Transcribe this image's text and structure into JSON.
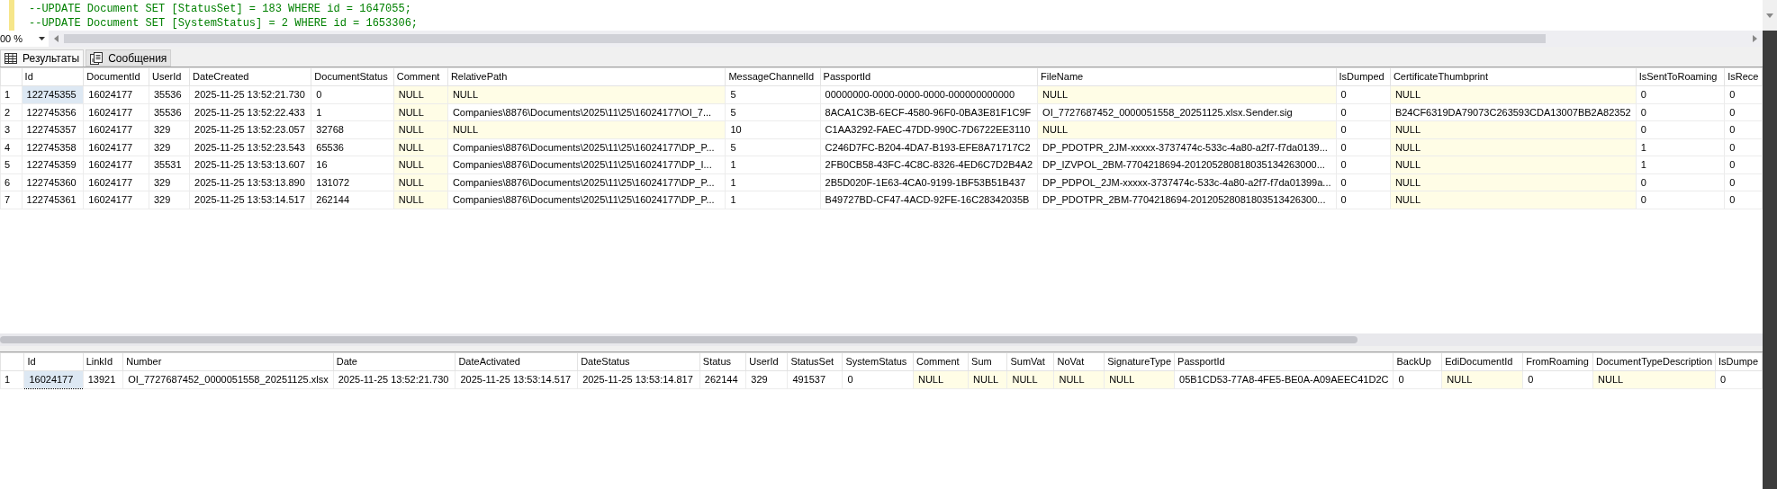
{
  "editor": {
    "lines": [
      "--UPDATE Document SET [StatusSet] = 183 WHERE id = 1647055;",
      "--UPDATE Document SET [SystemStatus] = 2 WHERE id = 1653306;"
    ]
  },
  "zoom": {
    "value": "00 %"
  },
  "tabs": [
    {
      "label": "Результаты",
      "selected": true,
      "kind": "grid"
    },
    {
      "label": "Сообщения",
      "selected": false,
      "kind": "messages"
    }
  ],
  "grids": [
    {
      "columns": [
        "Id",
        "DocumentId",
        "UserId",
        "DateCreated",
        "DocumentStatus",
        "Comment",
        "RelativePath",
        "MessageChannelId",
        "PassportId",
        "FileName",
        "IsDumped",
        "CertificateThumbprint",
        "IsSentToRoaming",
        "IsRece"
      ],
      "rows": [
        {
          "number": "1",
          "cells": [
            {
              "text": "122745355",
              "is_null": false,
              "selected": true
            },
            {
              "text": "16024177",
              "is_null": false,
              "selected": false
            },
            {
              "text": "35536",
              "is_null": false,
              "selected": false
            },
            {
              "text": "2025-11-25 13:52:21.730",
              "is_null": false,
              "selected": false
            },
            {
              "text": "0",
              "is_null": false,
              "selected": false
            },
            {
              "text": "NULL",
              "is_null": true,
              "selected": false
            },
            {
              "text": "NULL",
              "is_null": true,
              "selected": false
            },
            {
              "text": "5",
              "is_null": false,
              "selected": false
            },
            {
              "text": "00000000-0000-0000-0000-000000000000",
              "is_null": false,
              "selected": false
            },
            {
              "text": "NULL",
              "is_null": true,
              "selected": false
            },
            {
              "text": "0",
              "is_null": false,
              "selected": false
            },
            {
              "text": "NULL",
              "is_null": true,
              "selected": false
            },
            {
              "text": "0",
              "is_null": false,
              "selected": false
            },
            {
              "text": "0",
              "is_null": false,
              "selected": false
            }
          ]
        },
        {
          "number": "2",
          "cells": [
            {
              "text": "122745356",
              "is_null": false,
              "selected": false
            },
            {
              "text": "16024177",
              "is_null": false,
              "selected": false
            },
            {
              "text": "35536",
              "is_null": false,
              "selected": false
            },
            {
              "text": "2025-11-25 13:52:22.433",
              "is_null": false,
              "selected": false
            },
            {
              "text": "1",
              "is_null": false,
              "selected": false
            },
            {
              "text": "NULL",
              "is_null": true,
              "selected": false
            },
            {
              "text": "Companies\\8876\\Documents\\2025\\11\\25\\16024177\\OI_7...",
              "is_null": false,
              "selected": false
            },
            {
              "text": "5",
              "is_null": false,
              "selected": false
            },
            {
              "text": "8ACA1C3B-6ECF-4580-96F0-0BA3E81F1C9F",
              "is_null": false,
              "selected": false
            },
            {
              "text": "OI_7727687452_0000051558_20251125.xlsx.Sender.sig",
              "is_null": false,
              "selected": false
            },
            {
              "text": "0",
              "is_null": false,
              "selected": false
            },
            {
              "text": "B24CF6319DA79073C263593CDA13007BB2A82352",
              "is_null": false,
              "selected": false
            },
            {
              "text": "0",
              "is_null": false,
              "selected": false
            },
            {
              "text": "0",
              "is_null": false,
              "selected": false
            }
          ]
        },
        {
          "number": "3",
          "cells": [
            {
              "text": "122745357",
              "is_null": false,
              "selected": false
            },
            {
              "text": "16024177",
              "is_null": false,
              "selected": false
            },
            {
              "text": "329",
              "is_null": false,
              "selected": false
            },
            {
              "text": "2025-11-25 13:52:23.057",
              "is_null": false,
              "selected": false
            },
            {
              "text": "32768",
              "is_null": false,
              "selected": false
            },
            {
              "text": "NULL",
              "is_null": true,
              "selected": false
            },
            {
              "text": "NULL",
              "is_null": true,
              "selected": false
            },
            {
              "text": "10",
              "is_null": false,
              "selected": false
            },
            {
              "text": "C1AA3292-FAEC-47DD-990C-7D6722EE3110",
              "is_null": false,
              "selected": false
            },
            {
              "text": "NULL",
              "is_null": true,
              "selected": false
            },
            {
              "text": "0",
              "is_null": false,
              "selected": false
            },
            {
              "text": "NULL",
              "is_null": true,
              "selected": false
            },
            {
              "text": "0",
              "is_null": false,
              "selected": false
            },
            {
              "text": "0",
              "is_null": false,
              "selected": false
            }
          ]
        },
        {
          "number": "4",
          "cells": [
            {
              "text": "122745358",
              "is_null": false,
              "selected": false
            },
            {
              "text": "16024177",
              "is_null": false,
              "selected": false
            },
            {
              "text": "329",
              "is_null": false,
              "selected": false
            },
            {
              "text": "2025-11-25 13:52:23.543",
              "is_null": false,
              "selected": false
            },
            {
              "text": "65536",
              "is_null": false,
              "selected": false
            },
            {
              "text": "NULL",
              "is_null": true,
              "selected": false
            },
            {
              "text": "Companies\\8876\\Documents\\2025\\11\\25\\16024177\\DP_P...",
              "is_null": false,
              "selected": false
            },
            {
              "text": "5",
              "is_null": false,
              "selected": false
            },
            {
              "text": "C246D7FC-B204-4DA7-B193-EFE8A71717C2",
              "is_null": false,
              "selected": false
            },
            {
              "text": "DP_PDOTPR_2JM-xxxxx-3737474c-533c-4a80-a2f7-f7da0139...",
              "is_null": false,
              "selected": false
            },
            {
              "text": "0",
              "is_null": false,
              "selected": false
            },
            {
              "text": "NULL",
              "is_null": true,
              "selected": false
            },
            {
              "text": "1",
              "is_null": false,
              "selected": false
            },
            {
              "text": "0",
              "is_null": false,
              "selected": false
            }
          ]
        },
        {
          "number": "5",
          "cells": [
            {
              "text": "122745359",
              "is_null": false,
              "selected": false
            },
            {
              "text": "16024177",
              "is_null": false,
              "selected": false
            },
            {
              "text": "35531",
              "is_null": false,
              "selected": false
            },
            {
              "text": "2025-11-25 13:53:13.607",
              "is_null": false,
              "selected": false
            },
            {
              "text": "16",
              "is_null": false,
              "selected": false
            },
            {
              "text": "NULL",
              "is_null": true,
              "selected": false
            },
            {
              "text": "Companies\\8876\\Documents\\2025\\11\\25\\16024177\\DP_I...",
              "is_null": false,
              "selected": false
            },
            {
              "text": "1",
              "is_null": false,
              "selected": false
            },
            {
              "text": "2FB0CB58-43FC-4C8C-8326-4ED6C7D2B4A2",
              "is_null": false,
              "selected": false
            },
            {
              "text": "DP_IZVPOL_2BM-7704218694-201205280818035134263000...",
              "is_null": false,
              "selected": false
            },
            {
              "text": "0",
              "is_null": false,
              "selected": false
            },
            {
              "text": "NULL",
              "is_null": true,
              "selected": false
            },
            {
              "text": "1",
              "is_null": false,
              "selected": false
            },
            {
              "text": "0",
              "is_null": false,
              "selected": false
            }
          ]
        },
        {
          "number": "6",
          "cells": [
            {
              "text": "122745360",
              "is_null": false,
              "selected": false
            },
            {
              "text": "16024177",
              "is_null": false,
              "selected": false
            },
            {
              "text": "329",
              "is_null": false,
              "selected": false
            },
            {
              "text": "2025-11-25 13:53:13.890",
              "is_null": false,
              "selected": false
            },
            {
              "text": "131072",
              "is_null": false,
              "selected": false
            },
            {
              "text": "NULL",
              "is_null": true,
              "selected": false
            },
            {
              "text": "Companies\\8876\\Documents\\2025\\11\\25\\16024177\\DP_P...",
              "is_null": false,
              "selected": false
            },
            {
              "text": "1",
              "is_null": false,
              "selected": false
            },
            {
              "text": "2B5D020F-1E63-4CA0-9199-1BF53B51B437",
              "is_null": false,
              "selected": false
            },
            {
              "text": "DP_PDPOL_2JM-xxxxx-3737474c-533c-4a80-a2f7-f7da01399a...",
              "is_null": false,
              "selected": false
            },
            {
              "text": "0",
              "is_null": false,
              "selected": false
            },
            {
              "text": "NULL",
              "is_null": true,
              "selected": false
            },
            {
              "text": "0",
              "is_null": false,
              "selected": false
            },
            {
              "text": "0",
              "is_null": false,
              "selected": false
            }
          ]
        },
        {
          "number": "7",
          "cells": [
            {
              "text": "122745361",
              "is_null": false,
              "selected": false
            },
            {
              "text": "16024177",
              "is_null": false,
              "selected": false
            },
            {
              "text": "329",
              "is_null": false,
              "selected": false
            },
            {
              "text": "2025-11-25 13:53:14.517",
              "is_null": false,
              "selected": false
            },
            {
              "text": "262144",
              "is_null": false,
              "selected": false
            },
            {
              "text": "NULL",
              "is_null": true,
              "selected": false
            },
            {
              "text": "Companies\\8876\\Documents\\2025\\11\\25\\16024177\\DP_P...",
              "is_null": false,
              "selected": false
            },
            {
              "text": "1",
              "is_null": false,
              "selected": false
            },
            {
              "text": "B49727BD-CF47-4ACD-92FE-16C28342035B",
              "is_null": false,
              "selected": false
            },
            {
              "text": "DP_PDOTPR_2BM-7704218694-20120528081803513426300...",
              "is_null": false,
              "selected": false
            },
            {
              "text": "0",
              "is_null": false,
              "selected": false
            },
            {
              "text": "NULL",
              "is_null": true,
              "selected": false
            },
            {
              "text": "0",
              "is_null": false,
              "selected": false
            },
            {
              "text": "0",
              "is_null": false,
              "selected": false
            }
          ]
        }
      ]
    },
    {
      "columns": [
        "Id",
        "LinkId",
        "Number",
        "Date",
        "DateActivated",
        "DateStatus",
        "Status",
        "UserId",
        "StatusSet",
        "SystemStatus",
        "Comment",
        "Sum",
        "SumVat",
        "NoVat",
        "SignatureType",
        "PassportId",
        "BackUp",
        "EdiDocumentId",
        "FromRoaming",
        "DocumentTypeDescription",
        "IsDumpe"
      ],
      "rows": [
        {
          "number": "1",
          "cells": [
            {
              "text": "16024177",
              "is_null": false,
              "selected": true
            },
            {
              "text": "13921",
              "is_null": false,
              "selected": false
            },
            {
              "text": "OI_7727687452_0000051558_20251125.xlsx",
              "is_null": false,
              "selected": false
            },
            {
              "text": "2025-11-25 13:52:21.730",
              "is_null": false,
              "selected": false
            },
            {
              "text": "2025-11-25 13:53:14.517",
              "is_null": false,
              "selected": false
            },
            {
              "text": "2025-11-25 13:53:14.817",
              "is_null": false,
              "selected": false
            },
            {
              "text": "262144",
              "is_null": false,
              "selected": false
            },
            {
              "text": "329",
              "is_null": false,
              "selected": false
            },
            {
              "text": "491537",
              "is_null": false,
              "selected": false
            },
            {
              "text": "0",
              "is_null": false,
              "selected": false
            },
            {
              "text": "NULL",
              "is_null": true,
              "selected": false
            },
            {
              "text": "NULL",
              "is_null": true,
              "selected": false
            },
            {
              "text": "NULL",
              "is_null": true,
              "selected": false
            },
            {
              "text": "NULL",
              "is_null": true,
              "selected": false
            },
            {
              "text": "NULL",
              "is_null": true,
              "selected": false
            },
            {
              "text": "05B1CD53-77A8-4FE5-BE0A-A09AEEC41D2C",
              "is_null": false,
              "selected": false
            },
            {
              "text": "0",
              "is_null": false,
              "selected": false
            },
            {
              "text": "NULL",
              "is_null": true,
              "selected": false
            },
            {
              "text": "0",
              "is_null": false,
              "selected": false
            },
            {
              "text": "NULL",
              "is_null": true,
              "selected": false
            },
            {
              "text": "0",
              "is_null": false,
              "selected": false
            }
          ]
        }
      ]
    }
  ]
}
